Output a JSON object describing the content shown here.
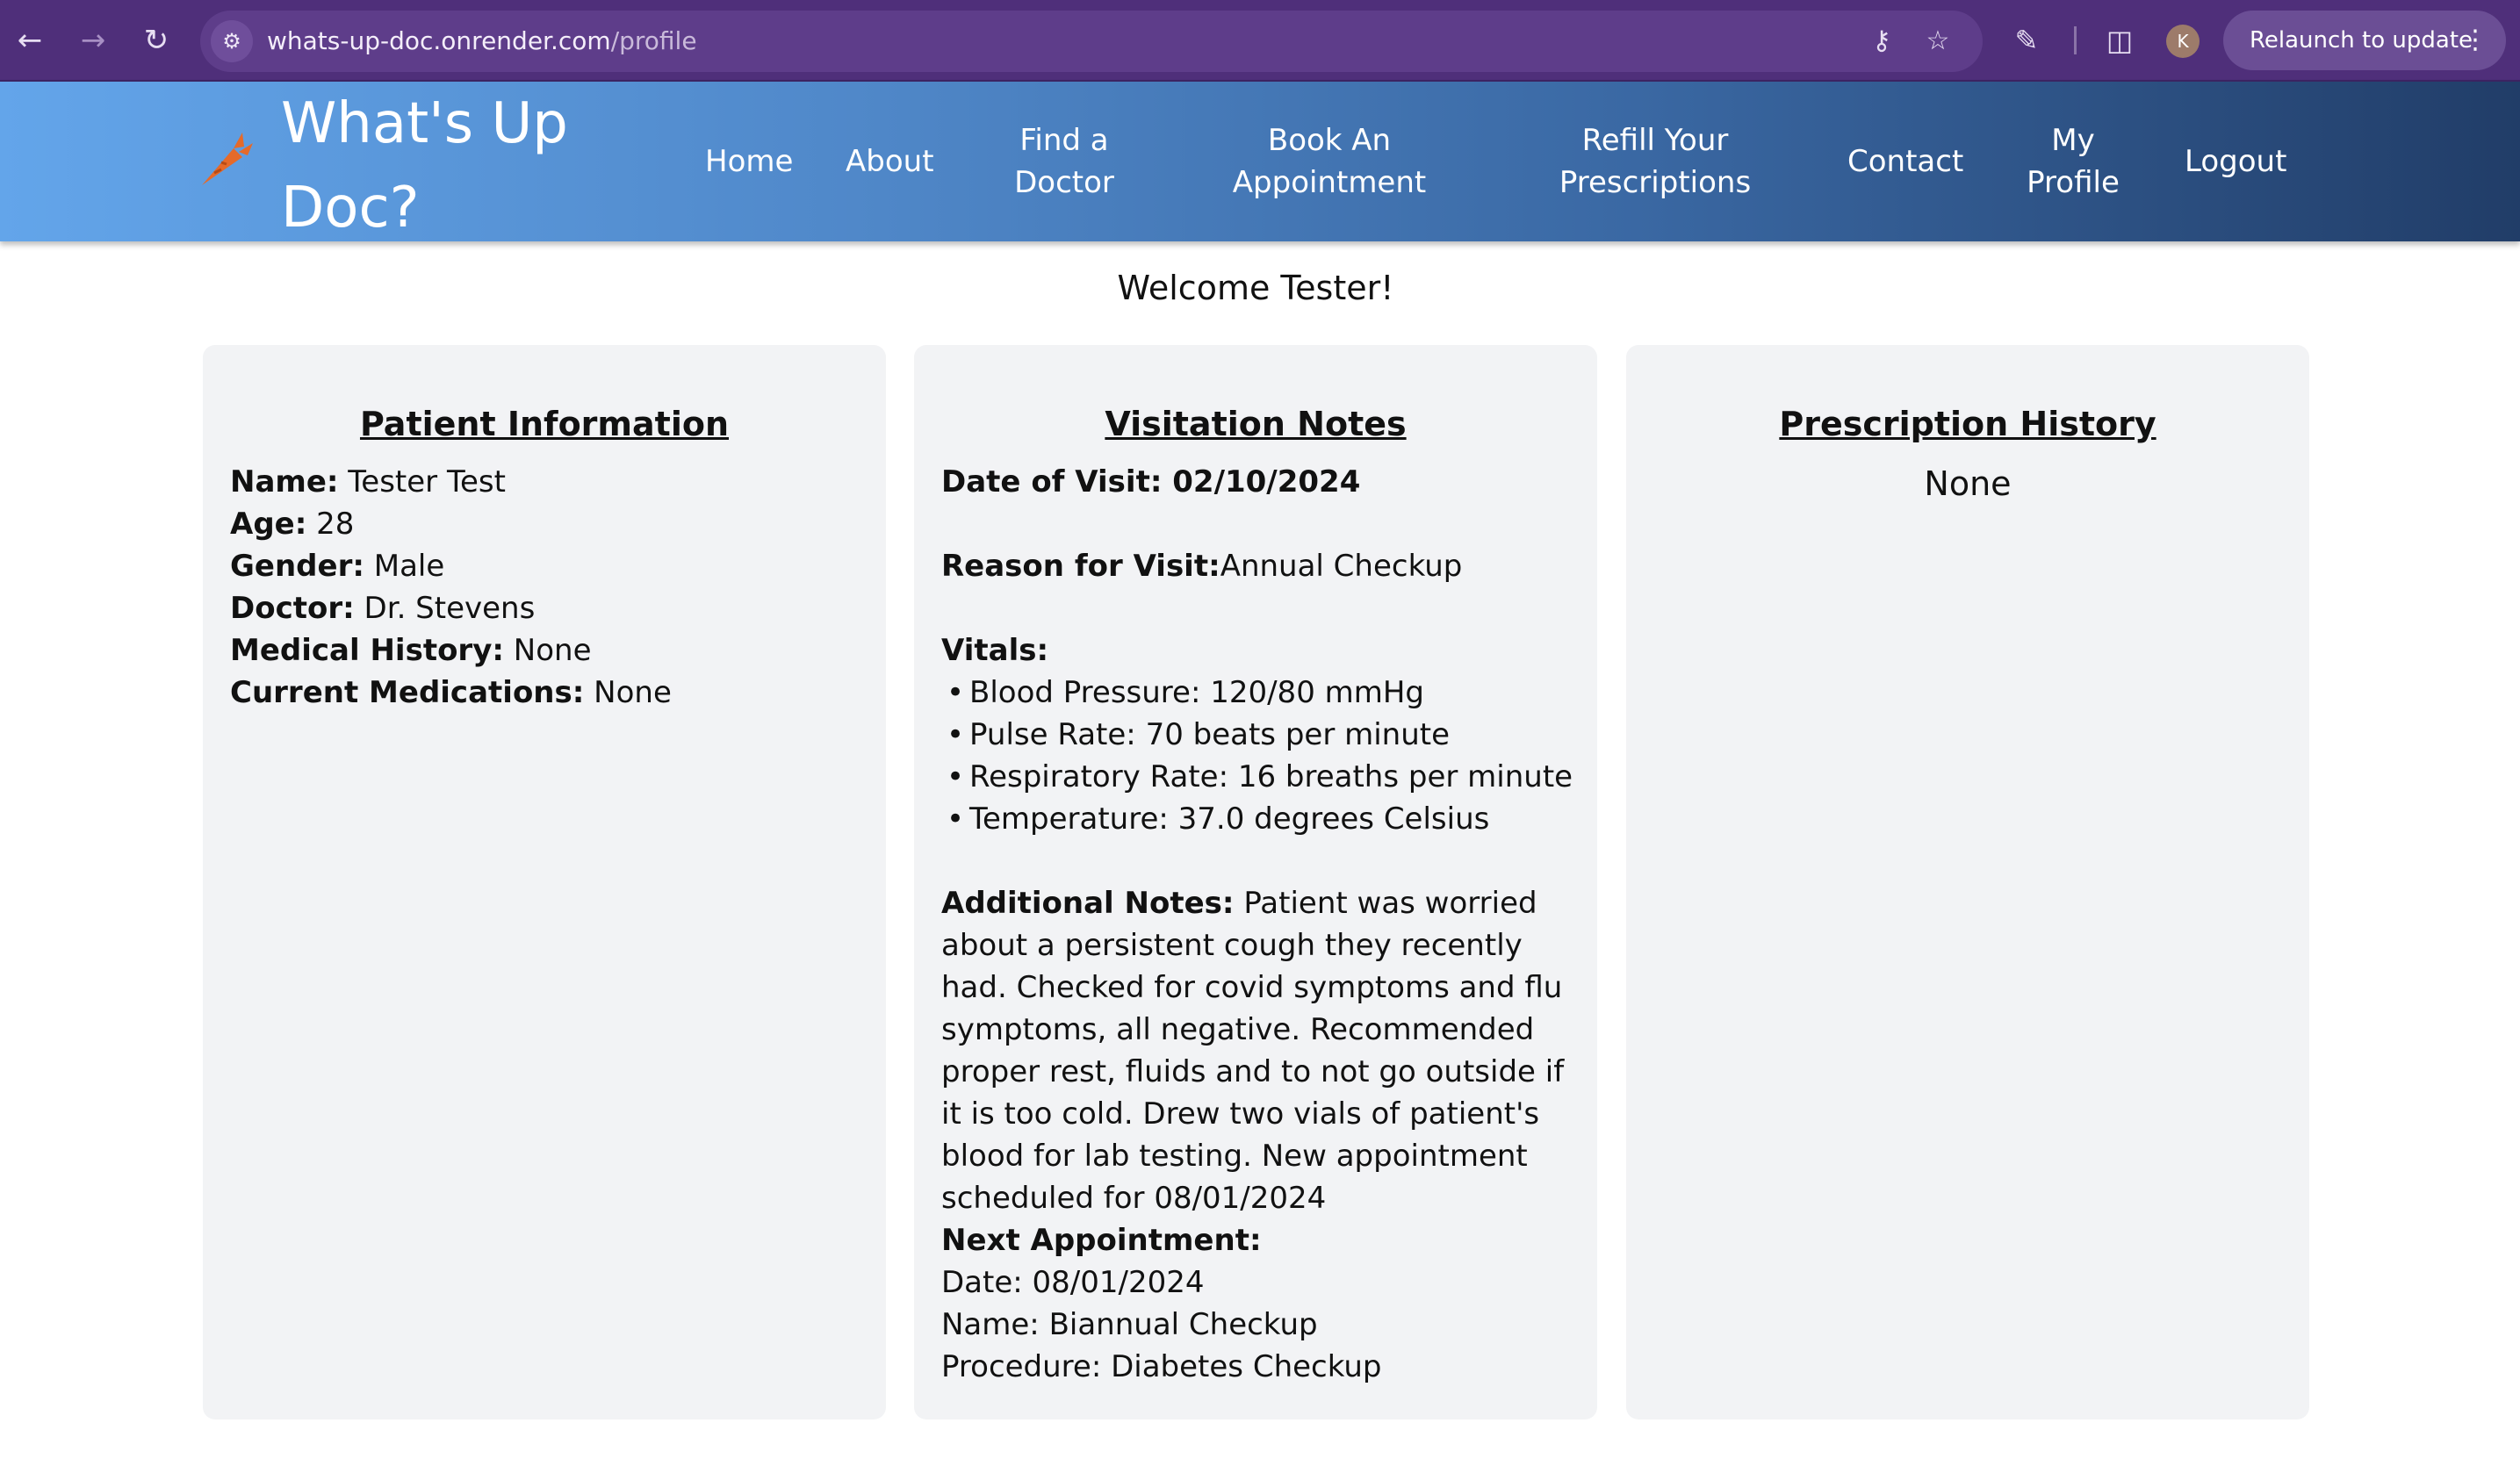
{
  "browser": {
    "url_host": "whats-up-doc.onrender.com",
    "url_path": "/profile",
    "profile_initial": "K",
    "relaunch_label": "Relaunch to update",
    "icons": [
      "back-icon",
      "forward-icon",
      "reload-icon",
      "site-settings-icon",
      "key-icon",
      "star-icon",
      "extensions-icon",
      "side-panel-icon",
      "more-icon"
    ]
  },
  "site": {
    "brand_line1": "What's Up",
    "brand_line2": "Doc?",
    "logo": "carrot-icon",
    "nav": {
      "home": "Home",
      "about": "About",
      "find_line1": "Find a",
      "find_line2": "Doctor",
      "book_line1": "Book An",
      "book_line2": "Appointment",
      "refill_line1": "Refill Your",
      "refill_line2": "Prescriptions",
      "contact": "Contact",
      "profile_line1": "My",
      "profile_line2": "Profile",
      "logout": "Logout"
    },
    "colors": {
      "header_start": "#63a5ea",
      "header_end": "#213d68",
      "card_bg": "#f2f3f5"
    }
  },
  "welcome": "Welcome Tester!",
  "patient": {
    "title": "Patient Information",
    "name_label": "Name:",
    "name": "Tester Test",
    "age_label": "Age:",
    "age": "28",
    "gender_label": "Gender:",
    "gender": "Male",
    "doctor_label": "Doctor:",
    "doctor": "Dr. Stevens",
    "history_label": "Medical History:",
    "history": "None",
    "meds_label": "Current Medications:",
    "meds": "None"
  },
  "visit": {
    "title": "Visitation Notes",
    "date_line": "Date of Visit: 02/10/2024",
    "reason_label": "Reason for Visit:",
    "reason": "Annual Checkup",
    "vitals_label": "Vitals:",
    "vitals": [
      "Blood Pressure: 120/80 mmHg",
      "Pulse Rate: 70 beats per minute",
      "Respiratory Rate: 16 breaths per minute",
      "Temperature: 37.0 degrees Celsius"
    ],
    "notes_label": "Additional Notes:",
    "notes": "Patient was worried about a persistent cough they recently had. Checked for covid symptoms and flu symptoms, all negative. Recommended proper rest, fluids and to not go outside if it is too cold. Drew two vials of patient's blood for lab testing. New appointment scheduled for 08/01/2024",
    "next_label": "Next Appointment:",
    "next_date": "Date: 08/01/2024",
    "next_name": "Name: Biannual Checkup",
    "next_procedure": "Procedure: Diabetes Checkup"
  },
  "prescriptions": {
    "title": "Prescription History",
    "empty_text": "None"
  }
}
